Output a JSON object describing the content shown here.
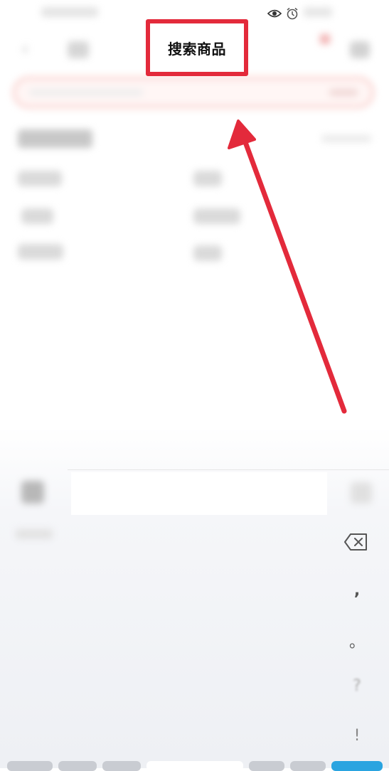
{
  "annotation": {
    "callout_text": "搜索商品",
    "color": "#e32a3b"
  },
  "keyboard": {
    "comma_key": ",",
    "period_key": "。",
    "question_key": "?",
    "exclaim_key": "!"
  },
  "icons": {
    "status_eye": "eye-icon",
    "status_alarm": "alarm-icon",
    "backspace": "backspace-icon"
  }
}
